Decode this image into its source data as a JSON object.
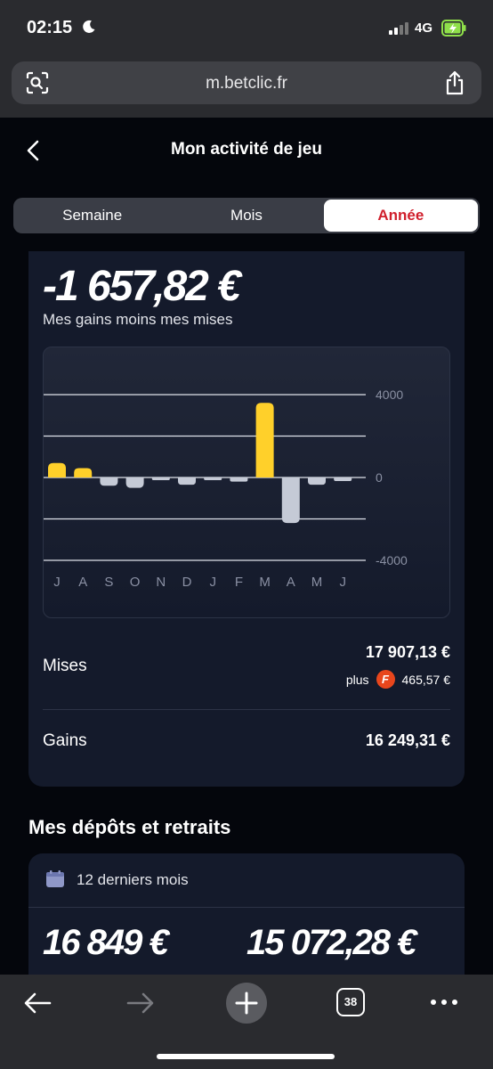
{
  "status_bar": {
    "time": "02:15",
    "network": "4G"
  },
  "browser": {
    "url": "m.betclic.fr",
    "tab_count": "38"
  },
  "header": {
    "title": "Mon activité de jeu"
  },
  "period_tabs": [
    {
      "label": "Semaine",
      "active": false
    },
    {
      "label": "Mois",
      "active": false
    },
    {
      "label": "Année",
      "active": true
    }
  ],
  "activity": {
    "net_amount": "-1 657,82 €",
    "net_caption": "Mes gains moins mes mises",
    "mises_label": "Mises",
    "mises_value": "17 907,13 €",
    "plus_label": "plus",
    "freebet_letter": "F",
    "freebet_value": "465,57 €",
    "gains_label": "Gains",
    "gains_value": "16 249,31 €"
  },
  "chart_data": {
    "type": "bar",
    "categories": [
      "J",
      "A",
      "S",
      "O",
      "N",
      "D",
      "J",
      "F",
      "M",
      "A",
      "M",
      "J"
    ],
    "values": [
      700,
      450,
      -400,
      -500,
      -60,
      -350,
      -40,
      -200,
      3600,
      -2200,
      -350,
      -170
    ],
    "ylim": [
      -4000,
      4000
    ],
    "y_ticks": [
      4000,
      0,
      -4000
    ],
    "gridlines": [
      4000,
      2000,
      0,
      -2000,
      -4000
    ],
    "positive_color": "#ffd02a",
    "negative_color": "#c5cad6",
    "grid": true
  },
  "deposits": {
    "section_title": "Mes dépôts et retraits",
    "period_label": "12 derniers mois",
    "deposit_amount": "16 849 €",
    "withdrawal_amount": "15 072,28 €"
  }
}
